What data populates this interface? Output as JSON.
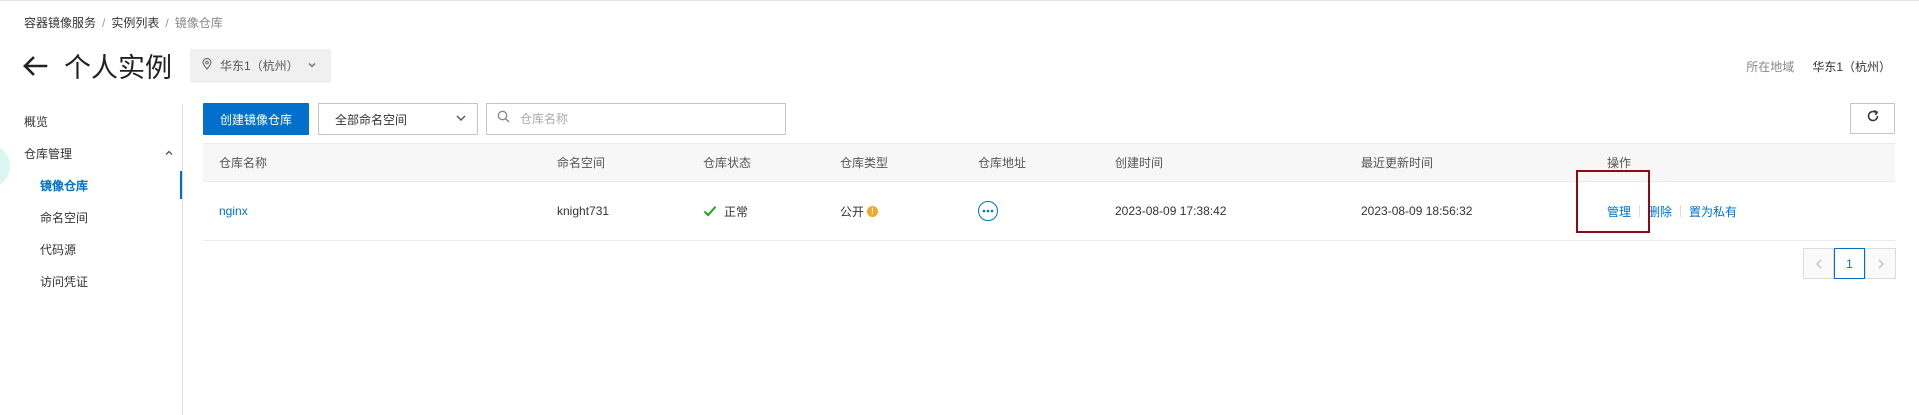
{
  "breadcrumb": {
    "level1": "容器镜像服务",
    "level2": "实例列表",
    "level3": "镜像仓库",
    "separator": "/"
  },
  "header": {
    "title": "个人实例",
    "region_select": "华东1（杭州）",
    "region_label": "所在地域",
    "region_value": "华东1（杭州）"
  },
  "sidebar": {
    "overview": "概览",
    "repo_mgmt": "仓库管理",
    "items": [
      {
        "label": "镜像仓库"
      },
      {
        "label": "命名空间"
      },
      {
        "label": "代码源"
      },
      {
        "label": "访问凭证"
      }
    ]
  },
  "toolbar": {
    "create_label": "创建镜像仓库",
    "namespace_filter": "全部命名空间",
    "search_placeholder": "仓库名称"
  },
  "table": {
    "headers": {
      "name": "仓库名称",
      "namespace": "命名空间",
      "status": "仓库状态",
      "type": "仓库类型",
      "address": "仓库地址",
      "created": "创建时间",
      "updated": "最近更新时间",
      "ops": "操作"
    },
    "rows": [
      {
        "name": "nginx",
        "namespace": "knight731",
        "status": "正常",
        "type": "公开",
        "created": "2023-08-09 17:38:42",
        "updated": "2023-08-09 18:56:32",
        "op_manage": "管理",
        "op_delete": "删除",
        "op_private": "置为私有"
      }
    ]
  },
  "pagination": {
    "current": "1"
  },
  "colors": {
    "accent": "#0070cc",
    "success": "#1ea51e",
    "warning": "#f5a623",
    "highlight_border": "#8b0a14"
  }
}
